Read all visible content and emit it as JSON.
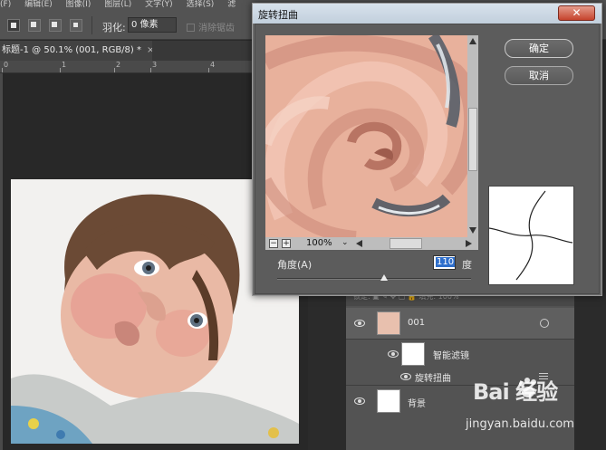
{
  "menubar": {
    "items": [
      "(F)",
      "编辑(E)",
      "图像(I)",
      "图层(L)",
      "文字(Y)",
      "选择(S)",
      "滤"
    ]
  },
  "options": {
    "feather_label": "羽化:",
    "feather_value": "0 像素",
    "antialias_label": "消除锯齿"
  },
  "document": {
    "tab_title": "标题-1 @ 50.1% (001, RGB/8) *",
    "close_glyph": "×",
    "ruler_ticks": [
      "0",
      "1",
      "2",
      "3",
      "4"
    ]
  },
  "dialog": {
    "title": "旋转扭曲",
    "close_glyph": "✕",
    "ok_label": "确定",
    "cancel_label": "取消",
    "zoom_value": "100%",
    "zoom_out": "−",
    "zoom_in": "+",
    "angle_label": "角度(A)",
    "angle_value": "110",
    "angle_unit": "度"
  },
  "layers": {
    "header_text": "锁定: ▣ ✎ ✥ ▢ 🔒   填充: 100%",
    "rows": [
      {
        "name": "001"
      },
      {
        "name": "智能滤镜"
      },
      {
        "name": "旋转扭曲"
      },
      {
        "name": "背景"
      }
    ]
  },
  "watermark": {
    "brand": "Bai 经验",
    "url": "jingyan.baidu.com"
  }
}
